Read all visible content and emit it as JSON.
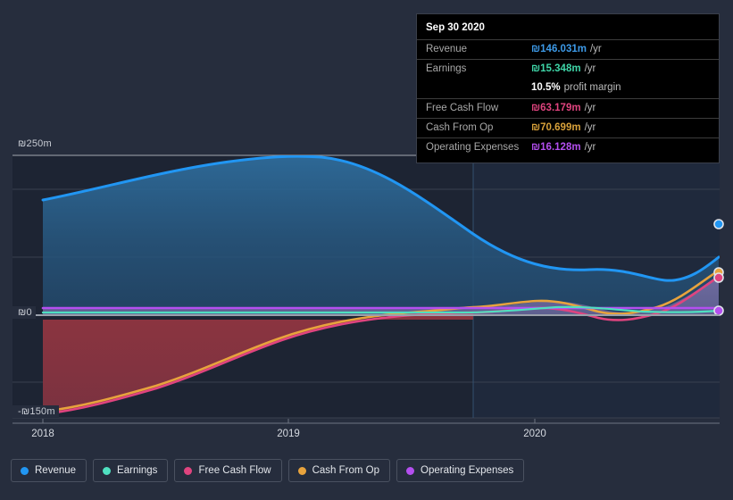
{
  "chart_data": {
    "type": "area",
    "title": "",
    "xlabel": "",
    "ylabel": "",
    "currency_symbol": "₪",
    "ylim": [
      -150,
      250
    ],
    "xlim": [
      2018,
      2020.75
    ],
    "grid": true,
    "legend_position": "bottom",
    "y_ticks": [
      {
        "value": 250,
        "label": "₪250m"
      },
      {
        "value": 0,
        "label": "₪0"
      },
      {
        "value": -150,
        "label": "-₪150m"
      }
    ],
    "x_ticks": [
      {
        "value": 2018,
        "label": "2018"
      },
      {
        "value": 2019,
        "label": "2019"
      },
      {
        "value": 2020,
        "label": "2020"
      }
    ],
    "x": [
      2018.0,
      2018.25,
      2018.5,
      2018.75,
      2019.0,
      2019.25,
      2019.5,
      2019.75,
      2020.0,
      2020.25,
      2020.5,
      2020.75
    ],
    "series": [
      {
        "name": "Revenue",
        "color": "#2196f3",
        "units": "m",
        "values": [
          205,
          216,
          225,
          230,
          231,
          222,
          202,
          183,
          176,
          174,
          166,
          146
        ]
      },
      {
        "name": "Earnings",
        "color": "#4fe0c0",
        "units": "m",
        "values": [
          2,
          2,
          2,
          2,
          2,
          2,
          3,
          4,
          8,
          9,
          6,
          15.348
        ]
      },
      {
        "name": "Free Cash Flow",
        "color": "#e0447f",
        "units": "m",
        "values": [
          -148,
          -140,
          -126,
          -106,
          -82,
          -56,
          -30,
          -6,
          5,
          -9,
          4,
          63.179
        ]
      },
      {
        "name": "Cash From Op",
        "color": "#e8a33d",
        "units": "m",
        "values": [
          -145,
          -137,
          -122,
          -102,
          -78,
          -51,
          -25,
          2,
          10,
          -4,
          12,
          70.699
        ]
      },
      {
        "name": "Operating Expenses",
        "color": "#b44ff0",
        "units": "m",
        "values": [
          7,
          7,
          7,
          7,
          7,
          7,
          7,
          7,
          7,
          7,
          7,
          16.128
        ]
      }
    ]
  },
  "tooltip": {
    "title": "Sep 30 2020",
    "rows": [
      {
        "label": "Revenue",
        "value": "₪146.031m",
        "unit": "/yr",
        "color": "#3d9ae8"
      },
      {
        "label": "Earnings",
        "value": "₪15.348m",
        "unit": "/yr",
        "color": "#3fd6a8"
      },
      {
        "label": "",
        "value": "10.5%",
        "unit": "profit margin",
        "color": "#ffffff"
      },
      {
        "label": "Free Cash Flow",
        "value": "₪63.179m",
        "unit": "/yr",
        "color": "#e0447f"
      },
      {
        "label": "Cash From Op",
        "value": "₪70.699m",
        "unit": "/yr",
        "color": "#d8a13a"
      },
      {
        "label": "Operating Expenses",
        "value": "₪16.128m",
        "unit": "/yr",
        "color": "#b44ff0"
      }
    ]
  },
  "legend": {
    "items": [
      {
        "label": "Revenue",
        "color": "#2196f3"
      },
      {
        "label": "Earnings",
        "color": "#4fe0c0"
      },
      {
        "label": "Free Cash Flow",
        "color": "#e0447f"
      },
      {
        "label": "Cash From Op",
        "color": "#e8a33d"
      },
      {
        "label": "Operating Expenses",
        "color": "#b44ff0"
      }
    ]
  },
  "axis": {
    "y_top_label": "₪250m",
    "y_zero_label": "₪0",
    "y_bottom_label": "-₪150m",
    "x_labels": [
      "2018",
      "2019",
      "2020"
    ]
  }
}
